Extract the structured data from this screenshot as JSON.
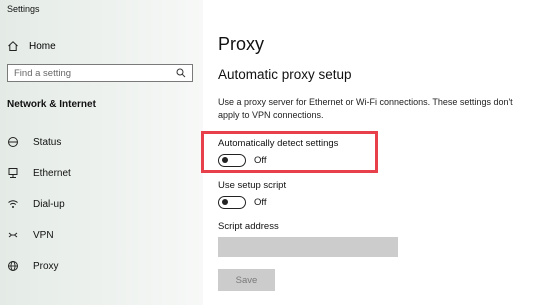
{
  "window": {
    "title": "Settings"
  },
  "sidebar": {
    "home_label": "Home",
    "search": {
      "placeholder": "Find a setting",
      "value": ""
    },
    "section_label": "Network & Internet",
    "items": [
      {
        "label": "Status",
        "icon": "globe-status-icon"
      },
      {
        "label": "Ethernet",
        "icon": "ethernet-icon"
      },
      {
        "label": "Dial-up",
        "icon": "dial-up-icon"
      },
      {
        "label": "VPN",
        "icon": "vpn-icon"
      },
      {
        "label": "Proxy",
        "icon": "globe-icon"
      }
    ]
  },
  "main": {
    "title": "Proxy",
    "subheading": "Automatic proxy setup",
    "description": "Use a proxy server for Ethernet or Wi-Fi connections. These settings don't apply to VPN connections.",
    "auto_detect": {
      "label": "Automatically detect settings",
      "state": "Off"
    },
    "setup_script": {
      "label": "Use setup script",
      "state": "Off"
    },
    "script_address": {
      "label": "Script address",
      "value": ""
    },
    "save_label": "Save"
  },
  "colors": {
    "highlight_border": "#e8404a",
    "disabled_bg": "#cccccc",
    "disabled_text": "#7a7a7a"
  }
}
